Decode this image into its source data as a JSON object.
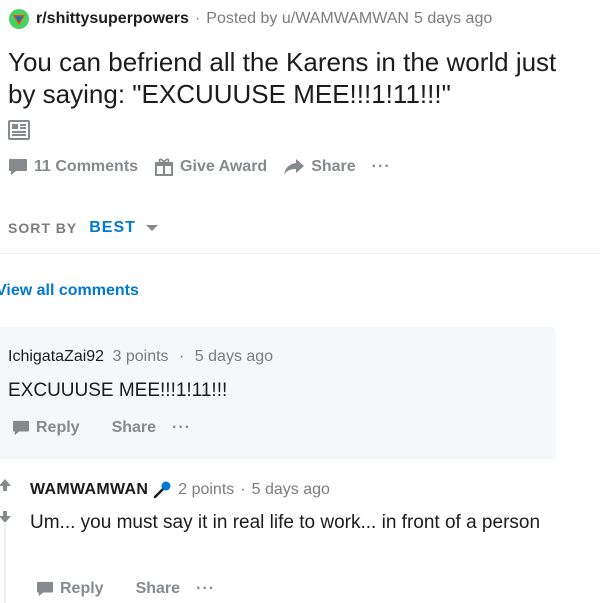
{
  "post": {
    "subreddit": "r/shittysuperpowers",
    "posted_by": "Posted by u/WAMWAMWAN",
    "age": "5 days ago",
    "title": "You can befriend all the Karens in the world just by saying: \"EXCUUUSE MEE!!!1!11!!!\"",
    "type_icon": "text-post-icon",
    "actions": {
      "comments": "11 Comments",
      "award": "Give Award",
      "share": "Share",
      "more": "···"
    }
  },
  "sort": {
    "label": "SORT BY",
    "value": "BEST"
  },
  "view_all": "View all comments",
  "comments": [
    {
      "author": "IchigataZai92",
      "points": "3 points",
      "age": "5 days ago",
      "body": "EXCUUUSE MEE!!!1!11!!!",
      "reply": "Reply",
      "share": "Share",
      "more": "···"
    },
    {
      "author": "WAMWAMWAN",
      "points": "2 points",
      "age": "5 days ago",
      "body": "Um... you must say it in real life to work... in front of a person",
      "reply": "Reply",
      "share": "Share",
      "more": "···"
    }
  ],
  "colors": {
    "accent": "#0079d3",
    "muted": "#878a8c",
    "comment_bg": "#f6f7f8"
  }
}
